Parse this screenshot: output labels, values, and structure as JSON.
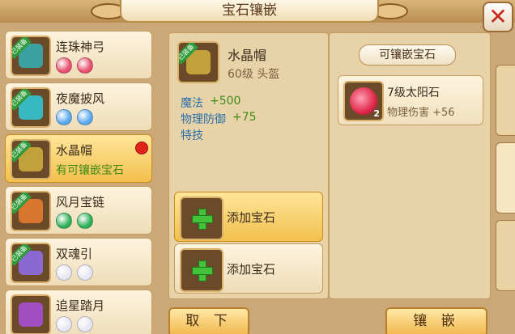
{
  "window": {
    "title": "宝石镶嵌",
    "close_glyph": "✕"
  },
  "equipment_list": [
    {
      "name": "连珠神弓",
      "badge": "已装备",
      "gems": [
        "#e8506e",
        "#e8506e"
      ],
      "note": "",
      "has_alert": false,
      "selected": false,
      "art_color": "#3ca0a0"
    },
    {
      "name": "夜魔披风",
      "badge": "已装备",
      "gems": [
        "#5aa9ef",
        "#5aa9ef"
      ],
      "note": "",
      "has_alert": false,
      "selected": false,
      "art_color": "#38b8c2"
    },
    {
      "name": "水晶帽",
      "badge": "已装备",
      "gems": [],
      "note": "有可镶嵌宝石",
      "has_alert": true,
      "selected": true,
      "art_color": "#c2a13a"
    },
    {
      "name": "风月宝链",
      "badge": "已装备",
      "gems": [
        "#2fb05a",
        "#2fb05a"
      ],
      "note": "",
      "has_alert": false,
      "selected": false,
      "art_color": "#d8762e"
    },
    {
      "name": "双魂引",
      "badge": "已装备",
      "gems": [
        "#e6e6f2",
        "#e6e6f2"
      ],
      "note": "",
      "has_alert": false,
      "selected": false,
      "art_color": "#8a6ad0"
    },
    {
      "name": "追星踏月",
      "badge": "",
      "gems": [
        "#e6e6f2",
        "#e6e6f2"
      ],
      "note": "",
      "has_alert": false,
      "selected": false,
      "art_color": "#a04ec2"
    }
  ],
  "detail": {
    "name": "水晶帽",
    "badge": "已装备",
    "level_slot": "60级  头盔",
    "stats": [
      {
        "label": "魔法",
        "value": "+500"
      },
      {
        "label": "物理防御",
        "value": "+75"
      }
    ],
    "skill": "特技",
    "slots": [
      {
        "label": "添加宝石",
        "highlight": true
      },
      {
        "label": "添加宝石",
        "highlight": false
      }
    ]
  },
  "gem_panel": {
    "header": "可镶嵌宝石",
    "gem": {
      "name": "7级太阳石",
      "stat": "物理伤害  +56",
      "count": "2"
    }
  },
  "buttons": {
    "remove": "取 下",
    "inlay": "镶 嵌"
  },
  "colors": {
    "selected": "#f2c04d",
    "stat_green": "#3f8a16",
    "stat_blue": "#2a6fa8",
    "alert": "#e1231c"
  }
}
